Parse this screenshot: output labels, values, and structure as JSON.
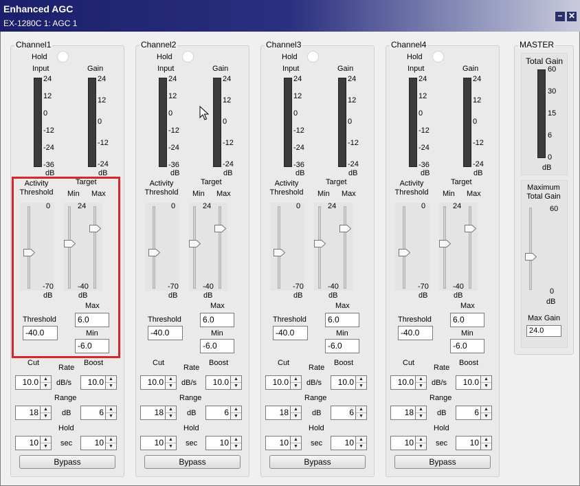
{
  "window": {
    "title": "Enhanced AGC",
    "subtitle": "EX-1280C 1: AGC 1",
    "minimize_glyph": "−",
    "close_glyph": "✕"
  },
  "channels": [
    {
      "name": "Channel1",
      "hold_label": "Hold",
      "input_label": "Input",
      "gain_label": "Gain",
      "input_scale": [
        "24",
        "12",
        "0",
        "-12",
        "-24",
        "-36"
      ],
      "gain_scale": [
        "24",
        "12",
        "0",
        "-12",
        "-24"
      ],
      "unit": "dB",
      "activity_threshold_label": "Activity\nThreshold",
      "target_label": "Target",
      "min_label": "Min",
      "max_label": "Max",
      "slider_top_activity": "0",
      "slider_bottom_activity": "-70",
      "slider_top_target": "24",
      "slider_bottom_target": "-40",
      "threshold_label": "Threshold",
      "threshold_value": "-40.0",
      "max_box_label": "Max",
      "max_value": "6.0",
      "min_box_label": "Min",
      "min_value": "-6.0",
      "cut_label": "Cut",
      "rate_label": "Rate",
      "boost_label": "Boost",
      "rate_unit": "dB/s",
      "cut_value": "10.0",
      "boost_value": "10.0",
      "range_label": "Range",
      "range_unit": "dB",
      "range_value": "18",
      "range_value2": "6",
      "hold_label2": "Hold",
      "hold_unit": "sec",
      "hold_value": "10",
      "hold_value2": "10",
      "bypass_label": "Bypass"
    },
    {
      "name": "Channel2",
      "hold_label": "Hold",
      "input_label": "Input",
      "gain_label": "Gain",
      "input_scale": [
        "24",
        "12",
        "0",
        "-12",
        "-24",
        "-36"
      ],
      "gain_scale": [
        "24",
        "12",
        "0",
        "-12",
        "-24"
      ],
      "unit": "dB",
      "activity_threshold_label": "Activity\nThreshold",
      "target_label": "Target",
      "min_label": "Min",
      "max_label": "Max",
      "slider_top_activity": "0",
      "slider_bottom_activity": "-70",
      "slider_top_target": "24",
      "slider_bottom_target": "-40",
      "threshold_label": "Threshold",
      "threshold_value": "-40.0",
      "max_box_label": "Max",
      "max_value": "6.0",
      "min_box_label": "Min",
      "min_value": "-6.0",
      "cut_label": "Cut",
      "rate_label": "Rate",
      "boost_label": "Boost",
      "rate_unit": "dB/s",
      "cut_value": "10.0",
      "boost_value": "10.0",
      "range_label": "Range",
      "range_unit": "dB",
      "range_value": "18",
      "range_value2": "6",
      "hold_label2": "Hold",
      "hold_unit": "sec",
      "hold_value": "10",
      "hold_value2": "10",
      "bypass_label": "Bypass"
    },
    {
      "name": "Channel3",
      "hold_label": "Hold",
      "input_label": "Input",
      "gain_label": "Gain",
      "input_scale": [
        "24",
        "12",
        "0",
        "-12",
        "-24",
        "-36"
      ],
      "gain_scale": [
        "24",
        "12",
        "0",
        "-12",
        "-24"
      ],
      "unit": "dB",
      "activity_threshold_label": "Activity\nThreshold",
      "target_label": "Target",
      "min_label": "Min",
      "max_label": "Max",
      "slider_top_activity": "0",
      "slider_bottom_activity": "-70",
      "slider_top_target": "24",
      "slider_bottom_target": "-40",
      "threshold_label": "Threshold",
      "threshold_value": "-40.0",
      "max_box_label": "Max",
      "max_value": "6.0",
      "min_box_label": "Min",
      "min_value": "-6.0",
      "cut_label": "Cut",
      "rate_label": "Rate",
      "boost_label": "Boost",
      "rate_unit": "dB/s",
      "cut_value": "10.0",
      "boost_value": "10.0",
      "range_label": "Range",
      "range_unit": "dB",
      "range_value": "18",
      "range_value2": "6",
      "hold_label2": "Hold",
      "hold_unit": "sec",
      "hold_value": "10",
      "hold_value2": "10",
      "bypass_label": "Bypass"
    },
    {
      "name": "Channel4",
      "hold_label": "Hold",
      "input_label": "Input",
      "gain_label": "Gain",
      "input_scale": [
        "24",
        "12",
        "0",
        "-12",
        "-24",
        "-36"
      ],
      "gain_scale": [
        "24",
        "12",
        "0",
        "-12",
        "-24"
      ],
      "unit": "dB",
      "activity_threshold_label": "Activity\nThreshold",
      "target_label": "Target",
      "min_label": "Min",
      "max_label": "Max",
      "slider_top_activity": "0",
      "slider_bottom_activity": "-70",
      "slider_top_target": "24",
      "slider_bottom_target": "-40",
      "threshold_label": "Threshold",
      "threshold_value": "-40.0",
      "max_box_label": "Max",
      "max_value": "6.0",
      "min_box_label": "Min",
      "min_value": "-6.0",
      "cut_label": "Cut",
      "rate_label": "Rate",
      "boost_label": "Boost",
      "rate_unit": "dB/s",
      "cut_value": "10.0",
      "boost_value": "10.0",
      "range_label": "Range",
      "range_unit": "dB",
      "range_value": "18",
      "range_value2": "6",
      "hold_label2": "Hold",
      "hold_unit": "sec",
      "hold_value": "10",
      "hold_value2": "10",
      "bypass_label": "Bypass"
    }
  ],
  "master": {
    "title": "MASTER",
    "total_gain_label": "Total Gain",
    "total_gain_scale": [
      "60",
      "30",
      "15",
      "6",
      "0"
    ],
    "unit": "dB",
    "max_total_gain_label": "Maximum\nTotal Gain",
    "slider_top": "60",
    "slider_bottom": "0",
    "slider_unit": "dB",
    "max_gain_label": "Max Gain",
    "max_gain_value": "24.0"
  },
  "colors": {
    "highlight_box": "#d9262b",
    "titlebar_start": "#1b1f6b"
  },
  "icons": {
    "cursor": "mouse-pointer-icon",
    "spin_up": "spin-up-arrow-icon",
    "spin_down": "spin-down-arrow-icon",
    "slider_thumb": "slider-thumb-icon"
  }
}
